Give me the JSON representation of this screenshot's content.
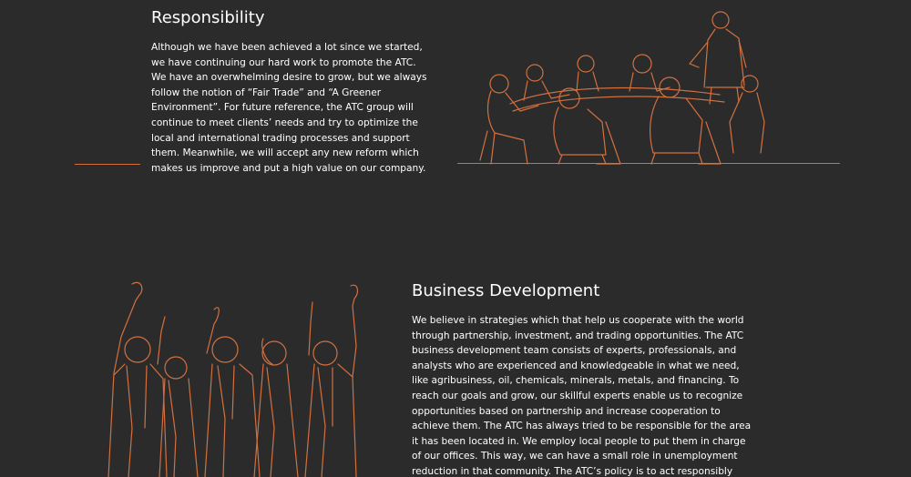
{
  "responsibility": {
    "title": "Responsibility",
    "lines": [
      "Although we have been achieved a lot since we started,",
      "we have continuing our hard work to promote the ATC.",
      "We have an overwhelming desire to grow, but we always",
      "follow the notion of “Fair Trade” and “A Greener",
      "Environment”. For future reference, the ATC group will",
      "continue to meet clients’ needs and try to optimize the",
      "local and international trading processes and support",
      "them. Meanwhile, we will accept any new reform which",
      "makes us improve and put a high value on our company."
    ],
    "illustration": "team-meeting-line-art"
  },
  "business_development": {
    "title": "Business Development",
    "lines": [
      "We believe in strategies which that help us cooperate with the world",
      "through partnership, investment, and trading opportunities. The ATC",
      "business development team consists of experts, professionals, and",
      "analysts who are experienced and knowledgeable in what we need,",
      "like agribusiness, oil, chemicals, minerals, metals, and financing. To",
      "reach our goals and grow, our skillful experts enable us to recognize",
      "opportunities based on partnership and increase cooperation to",
      "achieve them. The ATC has always tried to be responsible for the area",
      "it has been located in. We employ local people to put them in charge",
      "of our offices. This way, we can have a small role in unemployment",
      "reduction in that community. The ATC’s policy is to act responsibly"
    ],
    "illustration": "celebrating-team-line-art"
  },
  "colors": {
    "background": "#2b2b2b",
    "text": "#ffffff",
    "accent": "#d2703f"
  }
}
